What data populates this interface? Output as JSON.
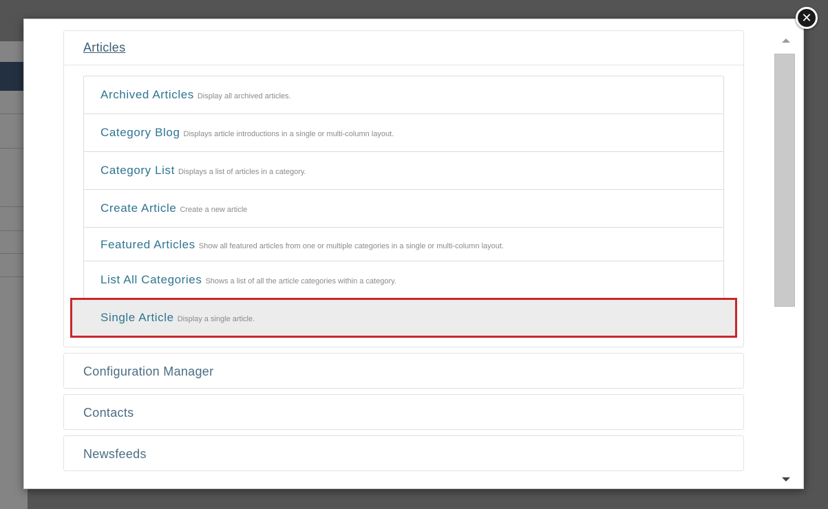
{
  "accordion": {
    "articles": {
      "heading": "Articles",
      "items": [
        {
          "title": "Archived Articles",
          "desc": "Display all archived articles."
        },
        {
          "title": "Category Blog",
          "desc": "Displays article introductions in a single or multi-column layout."
        },
        {
          "title": "Category List",
          "desc": "Displays a list of articles in a category."
        },
        {
          "title": "Create Article",
          "desc": "Create a new article"
        },
        {
          "title": "Featured Articles",
          "desc": "Show all featured articles from one or multiple categories in a single or multi-column layout."
        },
        {
          "title": "List All Categories",
          "desc": "Shows a list of all the article categories within a category."
        },
        {
          "title": "Single Article",
          "desc": "Display a single article."
        }
      ]
    },
    "configuration_manager": {
      "heading": "Configuration Manager"
    },
    "contacts": {
      "heading": "Contacts"
    },
    "newsfeeds": {
      "heading": "Newsfeeds"
    }
  },
  "close_icon": "close-icon",
  "highlight_color": "#c8272c",
  "link_color": "#2d7590"
}
